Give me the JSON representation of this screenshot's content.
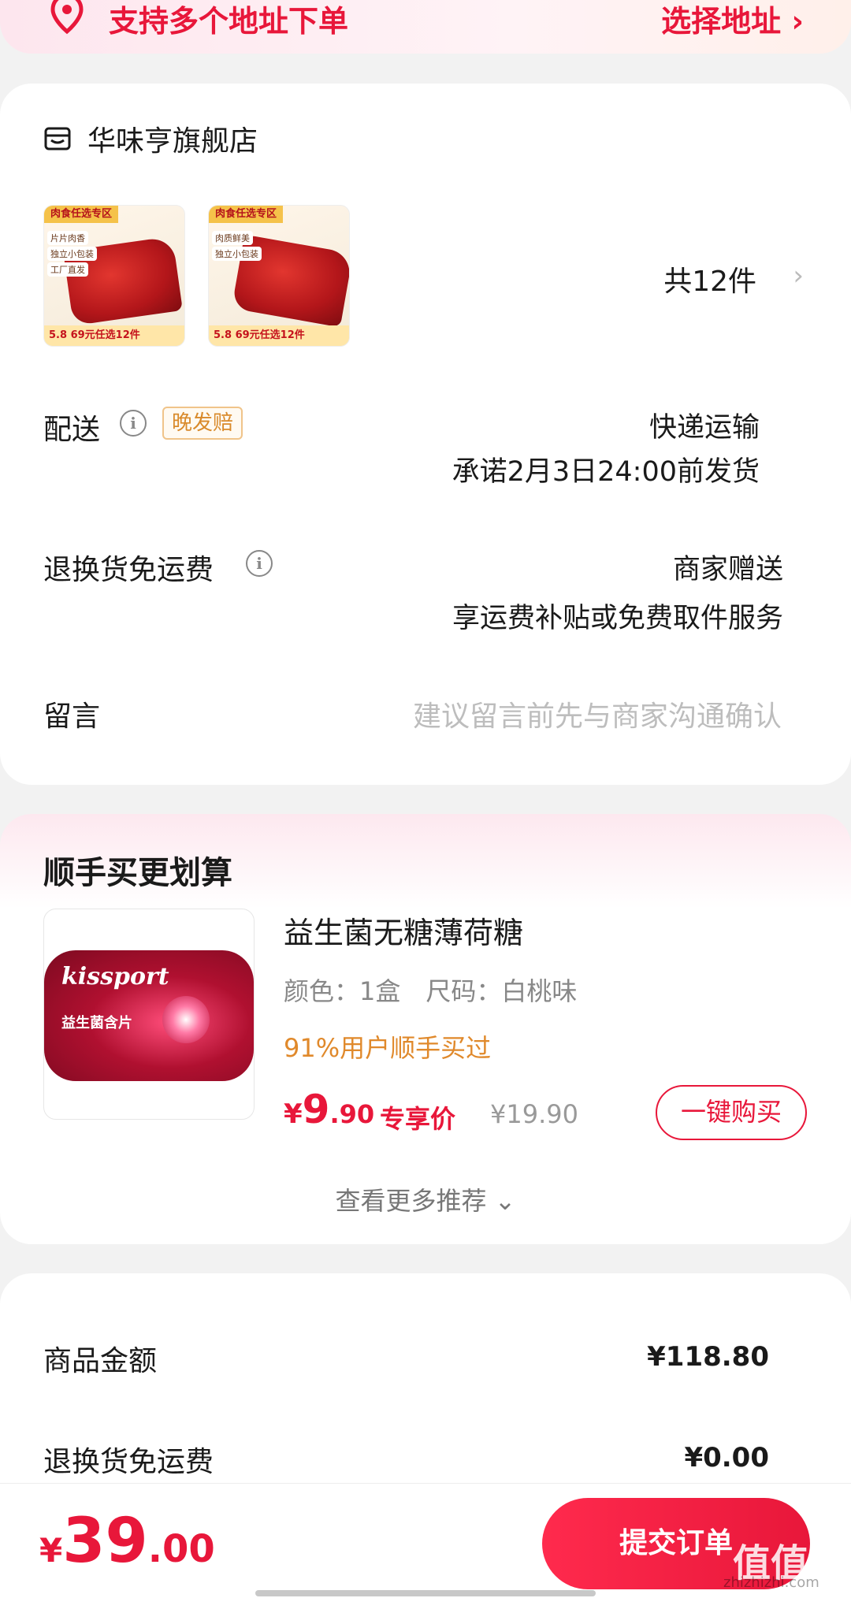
{
  "address_banner": {
    "text": "支持多个地址下单",
    "action": "选择地址 ›"
  },
  "store": {
    "name": "华味亨旗舰店",
    "thumb_tag": "肉食任选专区",
    "thumb1_labels": [
      "片片肉香",
      "独立小包装",
      "工厂直发"
    ],
    "thumb2_labels": [
      "肉质鲜美",
      "独立小包装"
    ],
    "thumb_price": "5.8",
    "thumb_promo": "69元任选12件",
    "count": "共12件",
    "arrow": "›"
  },
  "delivery": {
    "label": "配送",
    "badge": "晚发赔",
    "method": "快递运输",
    "promise": "承诺2月3日24:00前发货"
  },
  "return_fee": {
    "label": "退换货免运费",
    "value": "商家赠送",
    "desc": "享运费补贴或免费取件服务"
  },
  "message": {
    "label": "留言",
    "placeholder": "建议留言前先与商家沟通确认"
  },
  "recommend": {
    "title": "顺手买更划算",
    "product": {
      "brand_text": "kissport",
      "image_sub": "益生菌含片",
      "name": "益生菌无糖薄荷糖",
      "spec": "颜色：1盒　尺码：白桃味",
      "tip": "91%用户顺手买过",
      "price_yen": "¥",
      "price_int": "9",
      "price_dec": ".90",
      "price_label": "专享价",
      "orig_price": "¥19.90",
      "buy_label": "一键购买"
    },
    "more_label": "查看更多推荐 ⌄"
  },
  "totals": {
    "goods_label": "商品金额",
    "goods_value": "¥118.80",
    "return_label": "退换货免运费",
    "return_value": "¥0.00"
  },
  "bottom": {
    "yen": "¥",
    "int": "39",
    "dec": ".00",
    "submit_label": "提交订单"
  },
  "watermark": {
    "main": "值值值",
    "sub": "zhizhizhi.com"
  },
  "colors": {
    "accent": "#e8173a",
    "warning": "#e0892b"
  }
}
